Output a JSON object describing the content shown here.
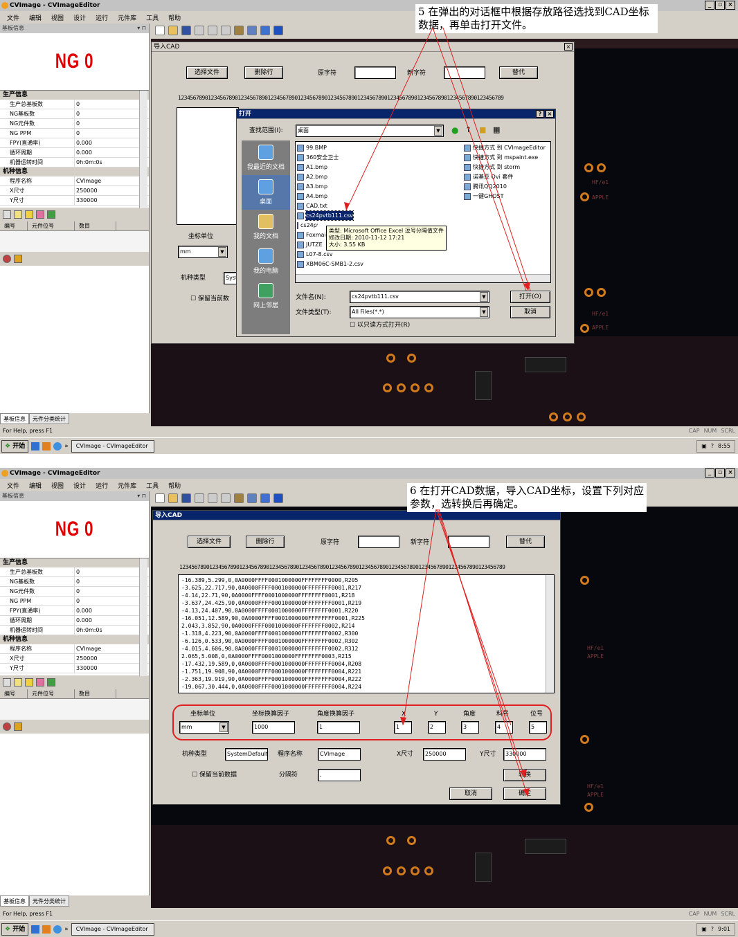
{
  "app": {
    "title": "CVImage - CVImageEditor",
    "menu": [
      "文件",
      "编辑",
      "视图",
      "设计",
      "运行",
      "元件库",
      "工具",
      "帮助"
    ],
    "left_pane_title": "基板信息",
    "ng_text": "NG 0",
    "props_cat1": "生产信息",
    "props_prod": [
      {
        "k": "生产总基板数",
        "v": "0"
      },
      {
        "k": "NG基板数",
        "v": "0"
      },
      {
        "k": "NG元件数",
        "v": "0"
      },
      {
        "k": "NG PPM",
        "v": "0"
      },
      {
        "k": "FPY(直通率)",
        "v": "0.000"
      },
      {
        "k": "循环周期",
        "v": "0.000"
      },
      {
        "k": "机器运转时间",
        "v": "0h:0m:0s"
      }
    ],
    "props_cat2": "机种信息",
    "props_model": [
      {
        "k": "程序名称",
        "v": "CVImage"
      },
      {
        "k": "X尺寸",
        "v": "250000"
      },
      {
        "k": "Y尺寸",
        "v": "330000"
      }
    ],
    "table_headers": [
      "编号",
      "元件位号",
      "数目"
    ],
    "left_tabs": [
      "基板信息",
      "元件分类统计"
    ],
    "status": "For Help, press F1",
    "status_ind": [
      "CAP",
      "NUM",
      "SCRL"
    ],
    "start": "开始",
    "task_item": "CVImage - CVImageEditor",
    "clock1": "8:55",
    "clock2": "9:01",
    "colors": {
      "ng_red": "#e00000",
      "dialog_blue": "#08246b",
      "annotation_red": "#e02020",
      "pcb": "#07070e"
    }
  },
  "step5": {
    "callout": "5 在弹出的对话框中根据存放路径选找到CAD坐标数据，再单击打开文件。",
    "dialog_title": "导入CAD",
    "select_file": "选择文件",
    "delete_row": "删除行",
    "orig_char": "原字符",
    "new_char": "新字符",
    "replace": "替代",
    "ruler": "1234567890123456789012345678901234567890123456789012345678901234567890123456789012345678901234567890123456789",
    "coord_unit": "坐标单位",
    "unit_val": "mm",
    "model_type": "机种类型",
    "model_val": "Syst",
    "keep_data": "保留当前数",
    "open": {
      "title": "打开",
      "lookin_label": "查找范围(I):",
      "lookin_val": "桌面",
      "places": [
        "我最近的文档",
        "桌面",
        "我的文档",
        "我的电脑",
        "网上邻居"
      ],
      "files_left": [
        "99.BMP",
        "360安全卫士",
        "A1.bmp",
        "A2.bmp",
        "A3.bmp",
        "A4.bmp",
        "CAD.txt",
        "cs24pvtb111.csv",
        "cs24pvtb222.csv",
        "Foxmail",
        "JUTZE",
        "L07-8.csv",
        "XBM06C-SMB1-2.csv"
      ],
      "files_right": [
        "快捷方式 到 CVImageEditor",
        "快捷方式 到 mspaint.exe",
        "快捷方式 到 storm",
        "诺基亚 Ovi 套件",
        "腾讯QQ2010",
        "一键GHOST"
      ],
      "tooltip": [
        "类型: Microsoft Office Excel 逗号分隔值文件",
        "修改日期: 2010-11-12 17:21",
        "大小: 3.55 KB"
      ],
      "filename_label": "文件名(N):",
      "filename_val": "cs24pvtb111.csv",
      "filetype_label": "文件类型(T):",
      "filetype_val": "All Files(*.*)",
      "readonly": "以只读方式打开(R)",
      "open_btn": "打开(O)",
      "cancel_btn": "取消"
    }
  },
  "step6": {
    "callout": "6 在打开CAD数据，导入CAD坐标，设置下列对应参数，选转换后再确定。",
    "dialog_title": "导入CAD",
    "select_file": "选择文件",
    "delete_row": "删除行",
    "orig_char": "原字符",
    "new_char": "新字符",
    "replace": "替代",
    "ruler": "1234567890123456789012345678901234567890123456789012345678901234567890123456789012345678901234567890123456789",
    "data_lines": [
      "-16.389,5.299,0,0A0000FFFF0001000000FFFFFFFF0000,R205",
      "-3.625,22.717,90,0A0000FFFF0001000000FFFFFFFF0001,R217",
      "-4.14,22.71,90,0A0000FFFF0001000000FFFFFFFF0001,R218",
      "-3.637,24.425,90,0A0000FFFF0001000000FFFFFFFF0001,R219",
      "-4.13,24.407,90,0A0000FFFF0001000000FFFFFFFF0001,R220",
      "-16.051,12.589,90,0A0000FFFF0001000000FFFFFFFF0001,R225",
      "2.043,3.852,90,0A0000FFFF0001000000FFFFFFFF0002,R214",
      "-1.318,4.223,90,0A0000FFFF0001000000FFFFFFFF0002,R300",
      "-6.126,0.533,90,0A0000FFFF0001000000FFFFFFFF0002,R302",
      "-4.015,4.606,90,0A0000FFFF0001000000FFFFFFFF0002,R312",
      "2.065,5.008,0,0A0000FFFF0001000000FFFFFFFF0003,R215",
      "-17.432,19.589,0,0A0000FFFF0001000000FFFFFFFF0004,R208",
      "-1.751,19.908,90,0A0000FFFF0001000000FFFFFFFF0004,R221",
      "-2.363,19.919,90,0A0000FFFF0001000000FFFFFFFF0004,R222",
      "-19.067,30.444,0,0A0000FFFF0001000000FFFFFFFF0004,R224"
    ],
    "params": {
      "unit_label": "坐标单位",
      "unit_val": "mm",
      "factor_label": "坐标换算因子",
      "factor_val": "1000",
      "angle_label": "角度换算因子",
      "angle_val": "1",
      "x_label": "X",
      "x_val": "1",
      "y_label": "Y",
      "y_val": "2",
      "ang_label": "角度",
      "ang_val": "3",
      "part_label": "料号",
      "part_val": "4",
      "ref_label": "位号",
      "ref_val": "5"
    },
    "model_type": "机种类型",
    "model_val": "SystemDefault",
    "prog_name": "程序名称",
    "prog_val": "CVImage",
    "xsize": "X尺寸",
    "xsize_val": "250000",
    "ysize": "Y尺寸",
    "ysize_val": "330000",
    "keep_data": "保留当前数据",
    "separator": "分隔符",
    "separator_val": ",",
    "convert": "转换",
    "cancel": "取消",
    "ok": "确定"
  }
}
